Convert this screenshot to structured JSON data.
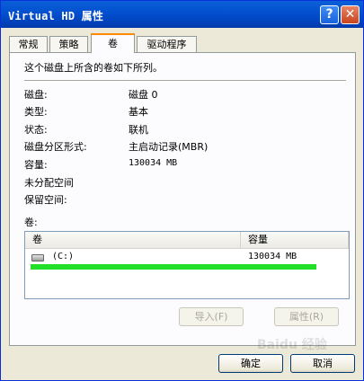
{
  "window": {
    "title": "Virtual HD 属性",
    "help_label": "?",
    "close_label": "✕"
  },
  "tabs": [
    {
      "label": "常规",
      "active": false
    },
    {
      "label": "策略",
      "active": false
    },
    {
      "label": "卷",
      "active": true
    },
    {
      "label": "驱动程序",
      "active": false
    }
  ],
  "panel": {
    "description": "这个磁盘上所含的卷如下所列。",
    "properties": [
      {
        "label": "磁盘:",
        "value": "磁盘 0"
      },
      {
        "label": "类型:",
        "value": "基本"
      },
      {
        "label": "状态:",
        "value": "联机"
      },
      {
        "label": "磁盘分区形式:",
        "value": "主启动记录(MBR)"
      },
      {
        "label": "容量:",
        "value": "130034 MB"
      },
      {
        "label": "未分配空间",
        "value": ""
      },
      {
        "label": "保留空间:",
        "value": ""
      }
    ],
    "volumes_label": "卷:",
    "list": {
      "columns": [
        "卷",
        "容量"
      ],
      "rows": [
        {
          "volume": "(C:)",
          "capacity": "130034 MB",
          "icon": "disk-icon"
        }
      ]
    },
    "import_button": "导入(F)",
    "properties_button": "属性(R)"
  },
  "footer": {
    "ok_button": "确定",
    "cancel_button": "取消"
  },
  "watermark": "Baidu 经验",
  "colors": {
    "title_bar": "#0451d0",
    "highlight_line": "#22e02a",
    "active_tab_accent": "#ff8a00"
  }
}
